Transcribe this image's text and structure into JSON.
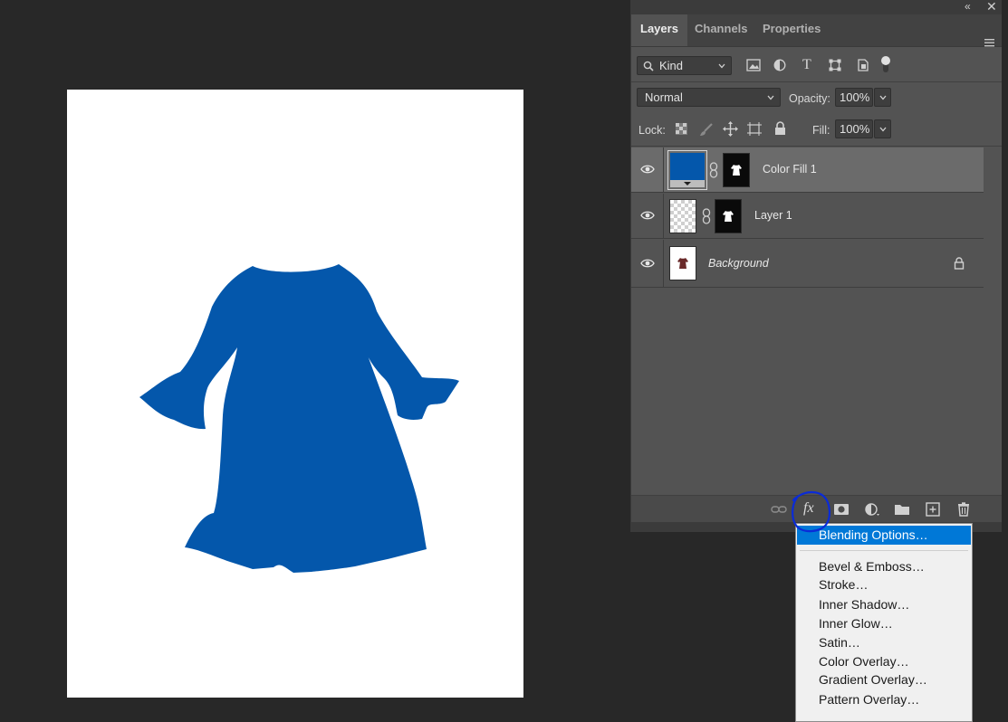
{
  "canvas": {
    "background": "#ffffff",
    "shape_color": "#0457ab"
  },
  "panel": {
    "tabs": [
      "Layers",
      "Channels",
      "Properties"
    ],
    "active_tab": "Layers",
    "filter": {
      "label": "Kind"
    },
    "blend_mode": "Normal",
    "opacity_label": "Opacity:",
    "opacity_value": "100%",
    "lock_label": "Lock:",
    "fill_label": "Fill:",
    "fill_value": "100%",
    "layers": [
      {
        "name": "Color Fill 1",
        "selected": true,
        "visible": true,
        "fill_color": "#0457ab"
      },
      {
        "name": "Layer 1",
        "selected": false,
        "visible": true
      },
      {
        "name": "Background",
        "selected": false,
        "visible": true,
        "locked": true
      }
    ]
  },
  "fx_menu": {
    "items": [
      "Blending Options…",
      "Bevel & Emboss…",
      "Stroke…",
      "Inner Shadow…",
      "Inner Glow…",
      "Satin…",
      "Color Overlay…",
      "Gradient Overlay…",
      "Pattern Overlay…"
    ],
    "highlighted": "Blending Options…",
    "highlight_color": "#0078d7"
  },
  "fx_button_label": "fx",
  "annotation_color": "#0a2bd8"
}
